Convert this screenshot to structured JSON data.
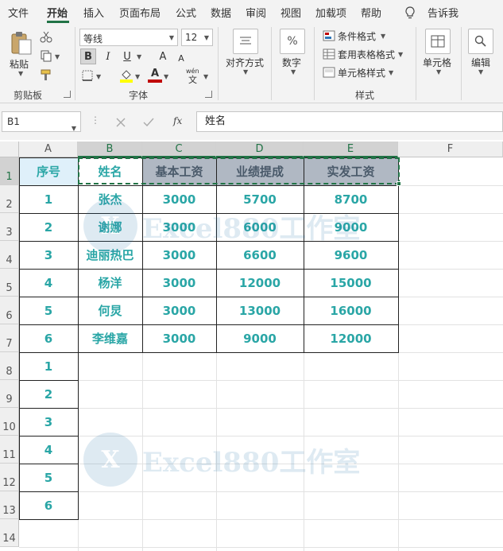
{
  "tabs": [
    "文件",
    "开始",
    "插入",
    "页面布局",
    "公式",
    "数据",
    "审阅",
    "视图",
    "加载项",
    "帮助",
    "告诉我"
  ],
  "ribbon": {
    "clipboard": {
      "paste": "粘贴",
      "group": "剪贴板"
    },
    "font": {
      "name": "等线",
      "size": "12",
      "bold": "B",
      "italic": "I",
      "underline": "U",
      "grow": "A",
      "shrink": "A",
      "phonetic": "wén",
      "group": "字体"
    },
    "alignment": {
      "label": "对齐方式"
    },
    "number": {
      "label": "数字",
      "icon_text": "%"
    },
    "styles": {
      "conditional": "条件格式",
      "table": "套用表格格式",
      "cell_styles": "单元格样式",
      "group": "样式"
    },
    "cells": {
      "label": "单元格"
    },
    "editing": {
      "label": "编辑"
    }
  },
  "formula_bar": {
    "name_box": "B1",
    "fx": "fx",
    "content": "姓名"
  },
  "columns": [
    "A",
    "B",
    "C",
    "D",
    "E",
    "F"
  ],
  "rows": [
    "1",
    "2",
    "3",
    "4",
    "5",
    "6",
    "7",
    "8",
    "9",
    "10",
    "11",
    "12",
    "13",
    "14"
  ],
  "table": {
    "headers": [
      "序号",
      "姓名",
      "基本工资",
      "业绩提成",
      "实发工资"
    ],
    "rows": [
      [
        "1",
        "张杰",
        "3000",
        "5700",
        "8700"
      ],
      [
        "2",
        "谢娜",
        "3000",
        "6000",
        "9000"
      ],
      [
        "3",
        "迪丽热巴",
        "3000",
        "6600",
        "9600"
      ],
      [
        "4",
        "杨洋",
        "3000",
        "12000",
        "15000"
      ],
      [
        "5",
        "何炅",
        "3000",
        "13000",
        "16000"
      ],
      [
        "6",
        "李维嘉",
        "3000",
        "9000",
        "12000"
      ]
    ],
    "extra_seq": [
      "1",
      "2",
      "3",
      "4",
      "5",
      "6"
    ]
  },
  "watermark": {
    "logo": "X",
    "text": "Excel880工作室"
  },
  "colors": {
    "accent": "#217346",
    "cell_text": "#2aa6a6",
    "header_fill": "#b0b8c3",
    "seq_fill": "#dff0fa"
  }
}
